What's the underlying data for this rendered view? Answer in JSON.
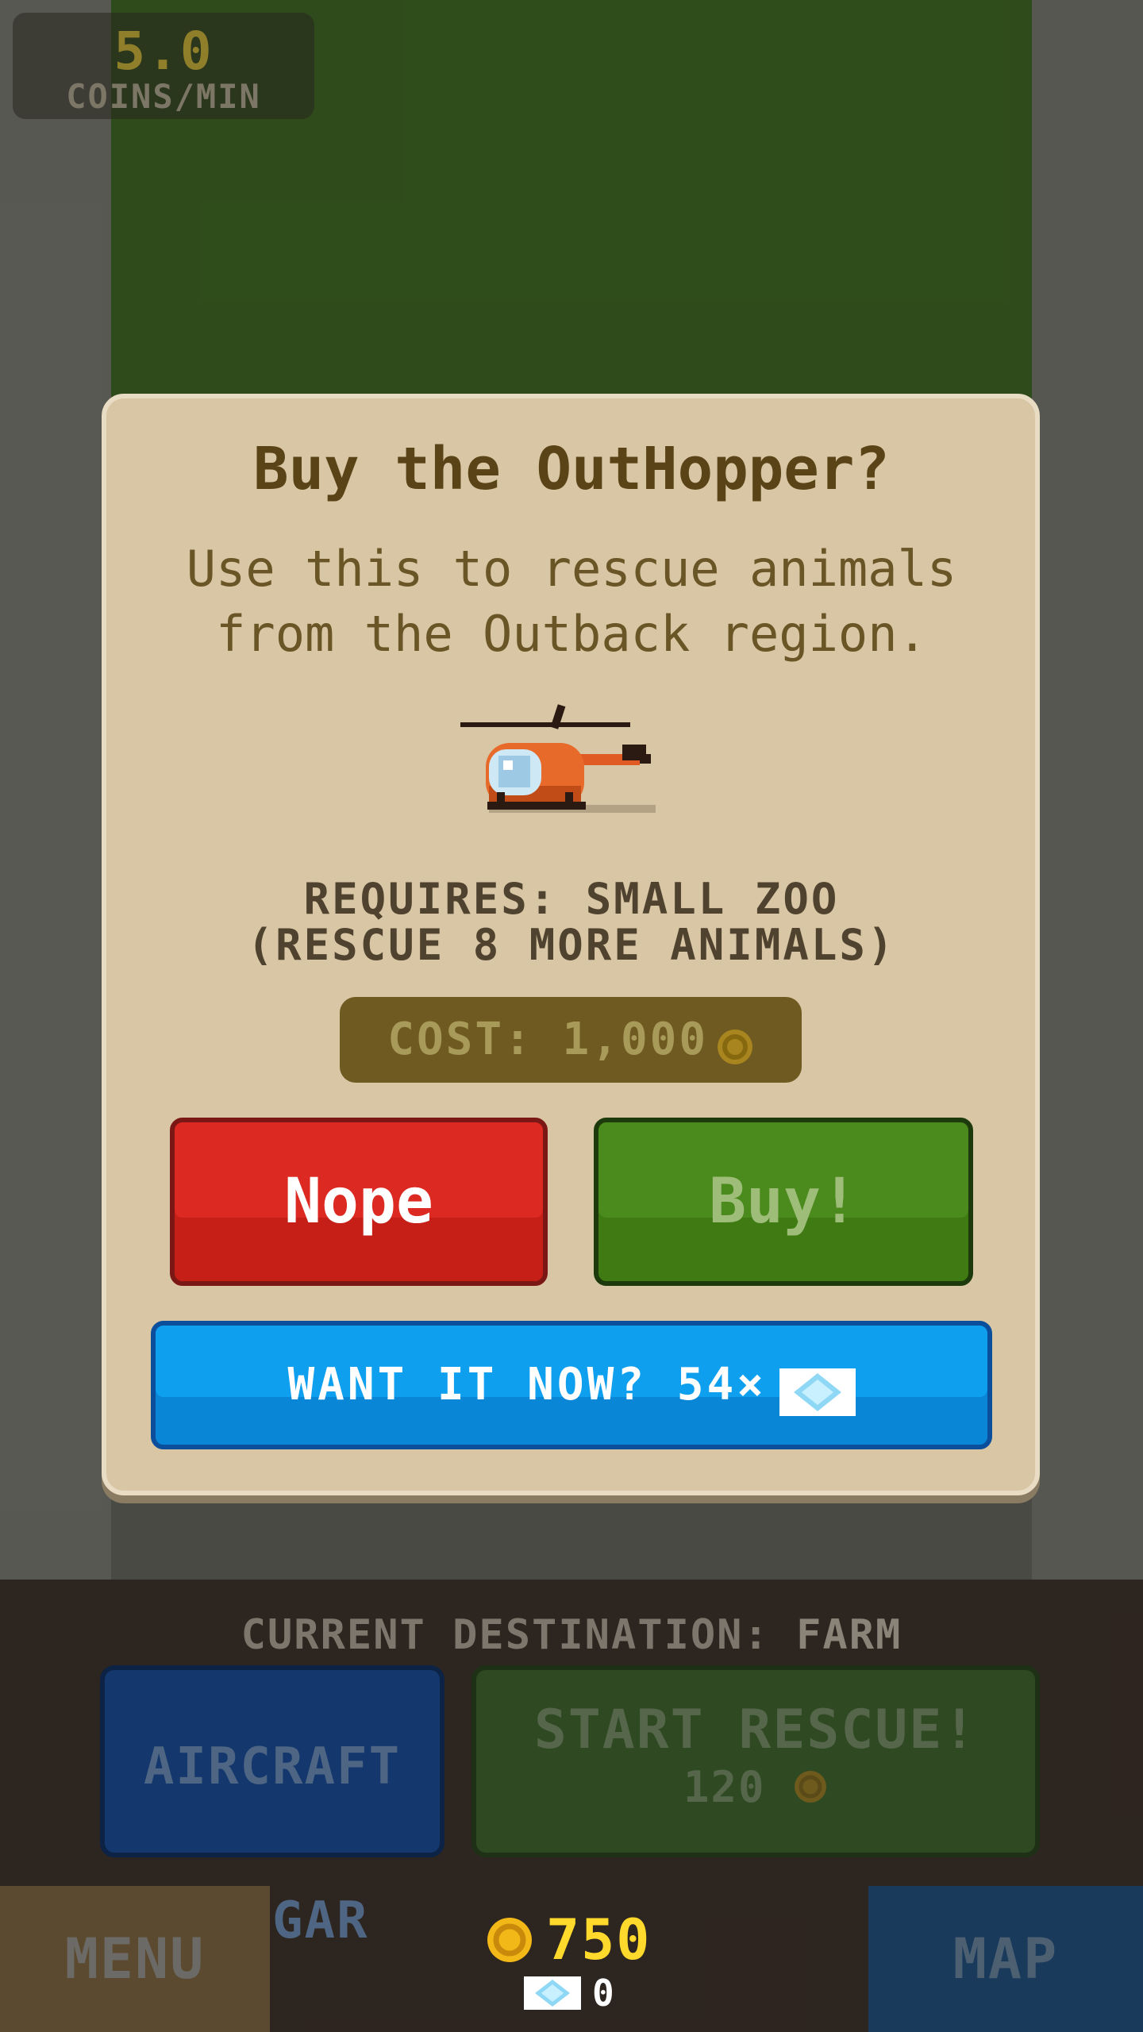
{
  "hud": {
    "coins_per_min_value": "5.0",
    "coins_per_min_label": "COINS/MIN"
  },
  "dialog": {
    "title": "Buy the OutHopper?",
    "description": "Use this to rescue animals from the Outback region.",
    "requires_line1": "REQUIRES: SMALL ZOO",
    "requires_line2": "(RESCUE 8 MORE ANIMALS)",
    "cost_label": "COST: 1,000",
    "nope_label": "Nope",
    "buy_label": "Buy!",
    "want_label": "WANT IT NOW? 54×",
    "item_icon": "helicopter-icon"
  },
  "bottom": {
    "destination_prefix": "CURRENT DESTINATION:",
    "destination_value": "FARM",
    "hangar_line1": "AIRCRAFT",
    "hangar_line2": "HANGAR",
    "rescue_label": "START RESCUE!",
    "rescue_cost": "120",
    "menu_label": "MENU",
    "map_label": "MAP",
    "coins": "750",
    "gems": "0"
  },
  "colors": {
    "dialog_bg": "#d8c6a4",
    "nope": "#dc2a22",
    "buy": "#4b8a1c",
    "want": "#0ea0ee",
    "coin": "#ffd92b"
  }
}
